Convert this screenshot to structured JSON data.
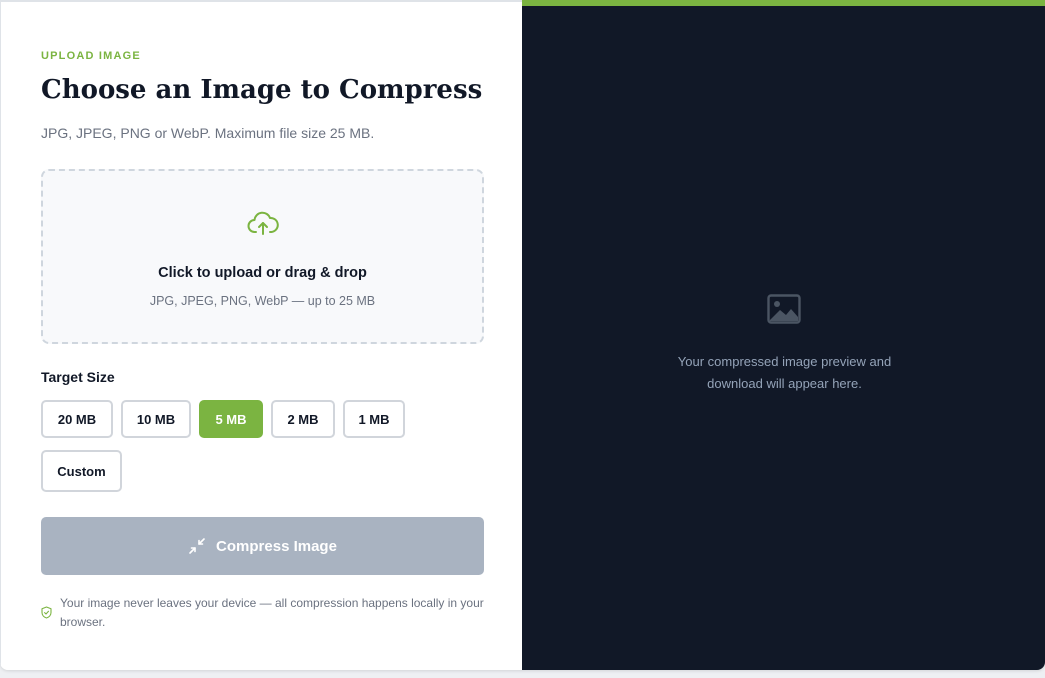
{
  "upload": {
    "eyebrow": "UPLOAD IMAGE",
    "title": "Choose an Image to Compress",
    "subtitle": "JPG, JPEG, PNG or WebP. Maximum file size 25 MB.",
    "dropzone": {
      "icon": "cloud-upload-icon",
      "title": "Click to upload or drag & drop",
      "subtitle": "JPG, JPEG, PNG, WebP — up to 25 MB"
    }
  },
  "target_size": {
    "label": "Target Size",
    "options": [
      {
        "label": "20 MB"
      },
      {
        "label": "10 MB"
      },
      {
        "label": "5 MB"
      },
      {
        "label": "2 MB"
      },
      {
        "label": "1 MB"
      },
      {
        "label": "Custom"
      }
    ],
    "selected": "5 MB"
  },
  "compress_button": {
    "label": "Compress Image",
    "icon": "compress-arrows-icon",
    "state": "disabled"
  },
  "privacy_note": {
    "icon": "shield-check-icon",
    "text": "Your image never leaves your device — all compression happens locally in your browser."
  },
  "preview": {
    "icon": "image-icon",
    "text": "Your compressed image preview and download will appear here."
  },
  "colors": {
    "accent": "#7bb441",
    "dark_panel": "#111827",
    "disabled_button": "#a9b3c1",
    "title_text": "#111827",
    "muted_text": "#6b7280"
  }
}
